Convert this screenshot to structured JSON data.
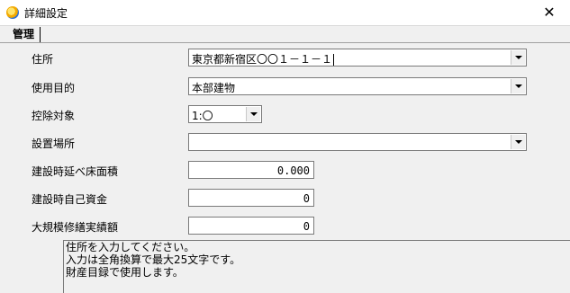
{
  "window": {
    "title": "詳細設定",
    "close_glyph": "✕"
  },
  "tab": {
    "label": "管理"
  },
  "fields": {
    "address": {
      "label": "住所",
      "value": "東京都新宿区〇〇１－１－１"
    },
    "purpose": {
      "label": "使用目的",
      "value": "本部建物"
    },
    "deduction": {
      "label": "控除対象",
      "value": "1:〇"
    },
    "location": {
      "label": "設置場所",
      "value": ""
    },
    "floor_area": {
      "label": "建設時延べ床面積",
      "value": "0.000"
    },
    "own_funds": {
      "label": "建設時自己資金",
      "value": "0"
    },
    "repair_record": {
      "label": "大規模修繕実績額",
      "value": "0"
    }
  },
  "help": {
    "lines": [
      "住所を入力してください。",
      "入力は全角換算で最大25文字です。",
      "財産目録で使用します。"
    ]
  }
}
